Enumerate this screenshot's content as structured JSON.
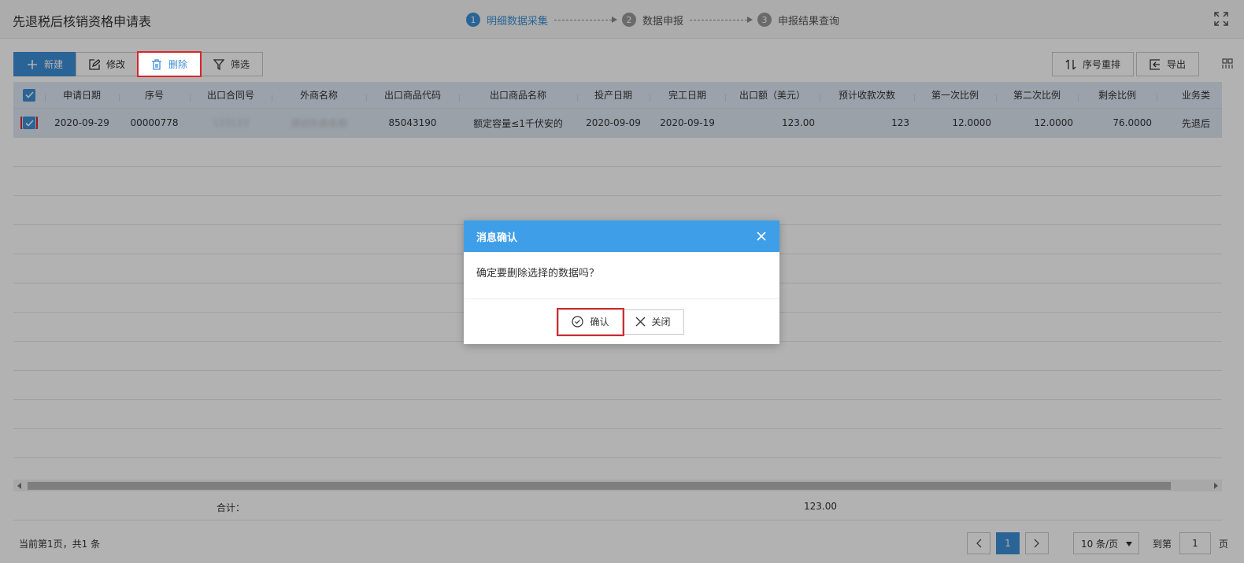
{
  "header": {
    "title": "先退税后核销资格申请表",
    "steps": [
      {
        "num": "1",
        "label": "明细数据采集"
      },
      {
        "num": "2",
        "label": "数据申报"
      },
      {
        "num": "3",
        "label": "申报结果查询"
      }
    ]
  },
  "toolbar": {
    "new_label": "新建",
    "edit_label": "修改",
    "delete_label": "删除",
    "filter_label": "筛选",
    "reorder_label": "序号重排",
    "export_label": "导出"
  },
  "table": {
    "columns": [
      "申请日期",
      "序号",
      "出口合同号",
      "外商名称",
      "出口商品代码",
      "出口商品名称",
      "投产日期",
      "完工日期",
      "出口额（美元）",
      "预计收款次数",
      "第一次比例",
      "第二次比例",
      "剩余比例",
      "业务类"
    ],
    "rows": [
      [
        "2020-09-29",
        "00000778",
        "123123",
        "测试外商名称",
        "85043190",
        "额定容量≤1千伏安的",
        "2020-09-09",
        "2020-09-19",
        "123.00",
        "123",
        "12.0000",
        "12.0000",
        "76.0000",
        "先退后"
      ]
    ],
    "total_label": "合计：",
    "total_value": "123.00"
  },
  "pager": {
    "info": "当前第1页，共1 条",
    "current_page": "1",
    "page_size": "10 条/页",
    "goto_label": "到第",
    "goto_value": "1",
    "unit": "页"
  },
  "dialog": {
    "title": "消息确认",
    "message": "确定要删除选择的数据吗？",
    "confirm_label": "确认",
    "close_label": "关闭"
  },
  "colors": {
    "accent": "#3d8fd6",
    "dialog_header": "#3f9ee8",
    "highlight": "#d9262c"
  }
}
